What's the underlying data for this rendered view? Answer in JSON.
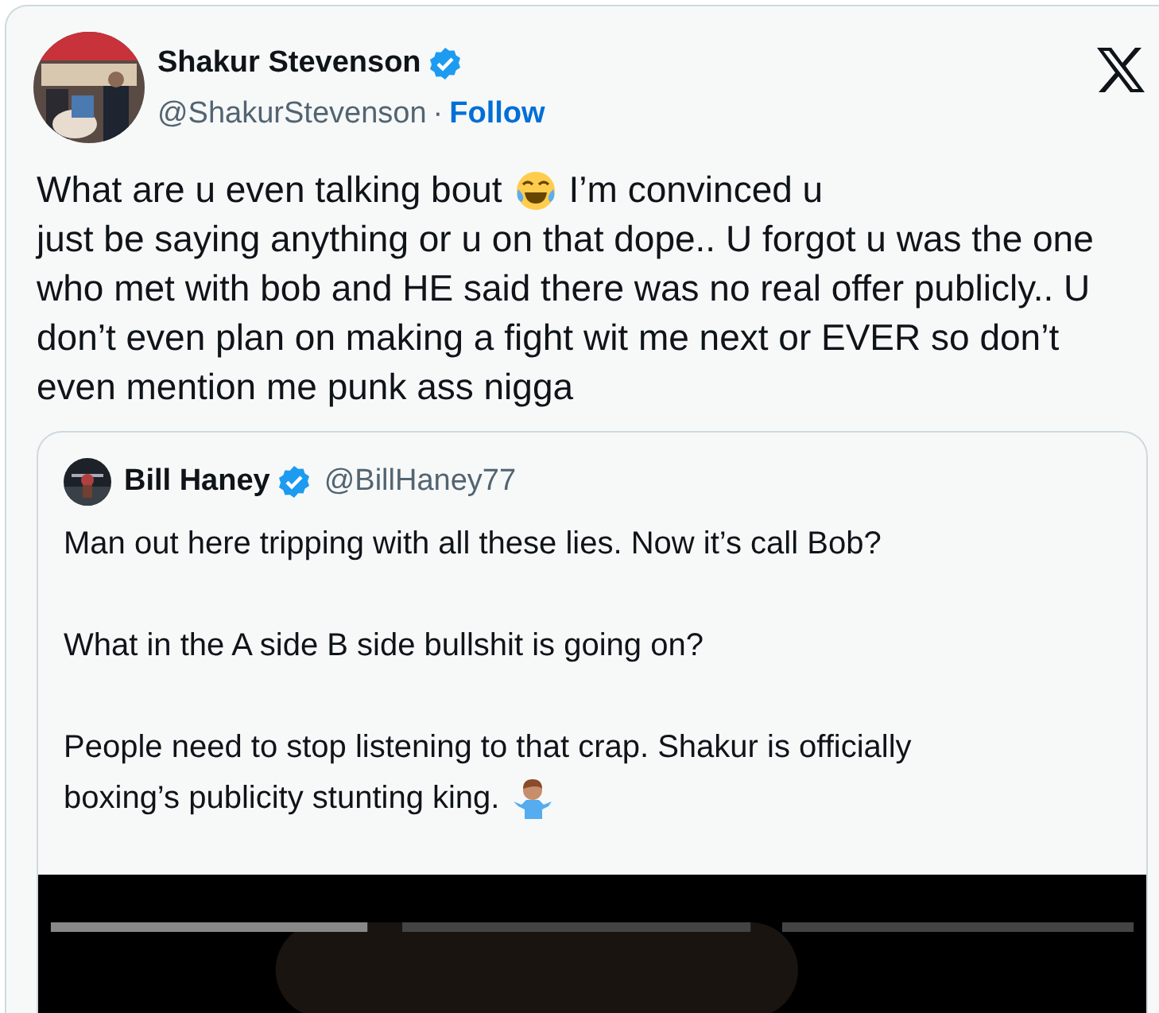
{
  "author": {
    "name": "Shakur Stevenson",
    "verified": true,
    "handle": "@ShakurStevenson",
    "separator": "·",
    "follow": "Follow"
  },
  "text": [
    [
      {
        "kind": "text",
        "text": "What are u even talking bout"
      },
      {
        "kind": "laugh"
      },
      {
        "kind": "text",
        "text": "I’m convinced u"
      }
    ],
    [
      {
        "kind": "text",
        "text": "just be saying anything or u on that dope.. U forgot u was the one who met with bob and HE said there was no real offer publicly.. U don’t even plan on making a fight wit me next or EVER so don’t even mention me punk ass nigga"
      }
    ]
  ],
  "quote": {
    "name": "Bill Haney",
    "verified": true,
    "handle": "@BillHaney77",
    "paragraphs": [
      [
        [
          {
            "kind": "text",
            "text": "Man out here tripping with all these lies. Now it’s call Bob?"
          }
        ]
      ],
      [
        [
          {
            "kind": "text",
            "text": "What in the A side B side bullshit is going on?"
          }
        ]
      ],
      [
        [
          {
            "kind": "text",
            "text": "People need to stop listening to that crap. Shakur is officially"
          }
        ],
        [
          {
            "kind": "text",
            "text": "boxing’s publicity stunting king."
          },
          {
            "kind": "shrug"
          }
        ]
      ]
    ],
    "media": {
      "kind": "picture"
    }
  }
}
